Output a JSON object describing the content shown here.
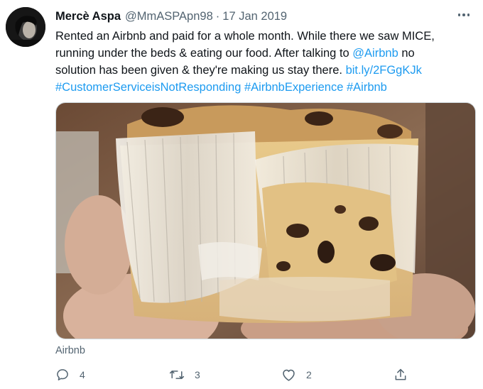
{
  "tweet": {
    "author": {
      "name": "Mercè Aspa",
      "handle": "@MmASPApn98",
      "date": "17 Jan 2019",
      "separator": "·"
    },
    "text": {
      "line1": "Rented an Airbnb and paid for a whole month. While there we saw MICE,",
      "line2": "running under the beds & eating our food. After talking to ",
      "mention": "@Airbnb",
      "line2_end": " no",
      "line3": "solution has been given & they're making us stay there. ",
      "url": "bit.ly/2FGgKJk",
      "hashtag1": "#CustomerServiceisNotResponding",
      "hashtag2": "#AirbnbExperience",
      "hashtag3": "#Airbnb"
    },
    "media": {
      "icon": "photo-icon",
      "description_hidden": ""
    },
    "source": "Airbnb",
    "actions": {
      "replies": "4",
      "retweets": "3",
      "likes": "2"
    },
    "icons": {
      "reply": "reply-icon",
      "retweet": "retweet-icon",
      "like": "heart-icon",
      "share": "share-icon",
      "more": "more-icon"
    },
    "colors": {
      "link": "#1d9bf0",
      "secondary_text": "#536471",
      "primary_text": "#0f1419"
    }
  }
}
